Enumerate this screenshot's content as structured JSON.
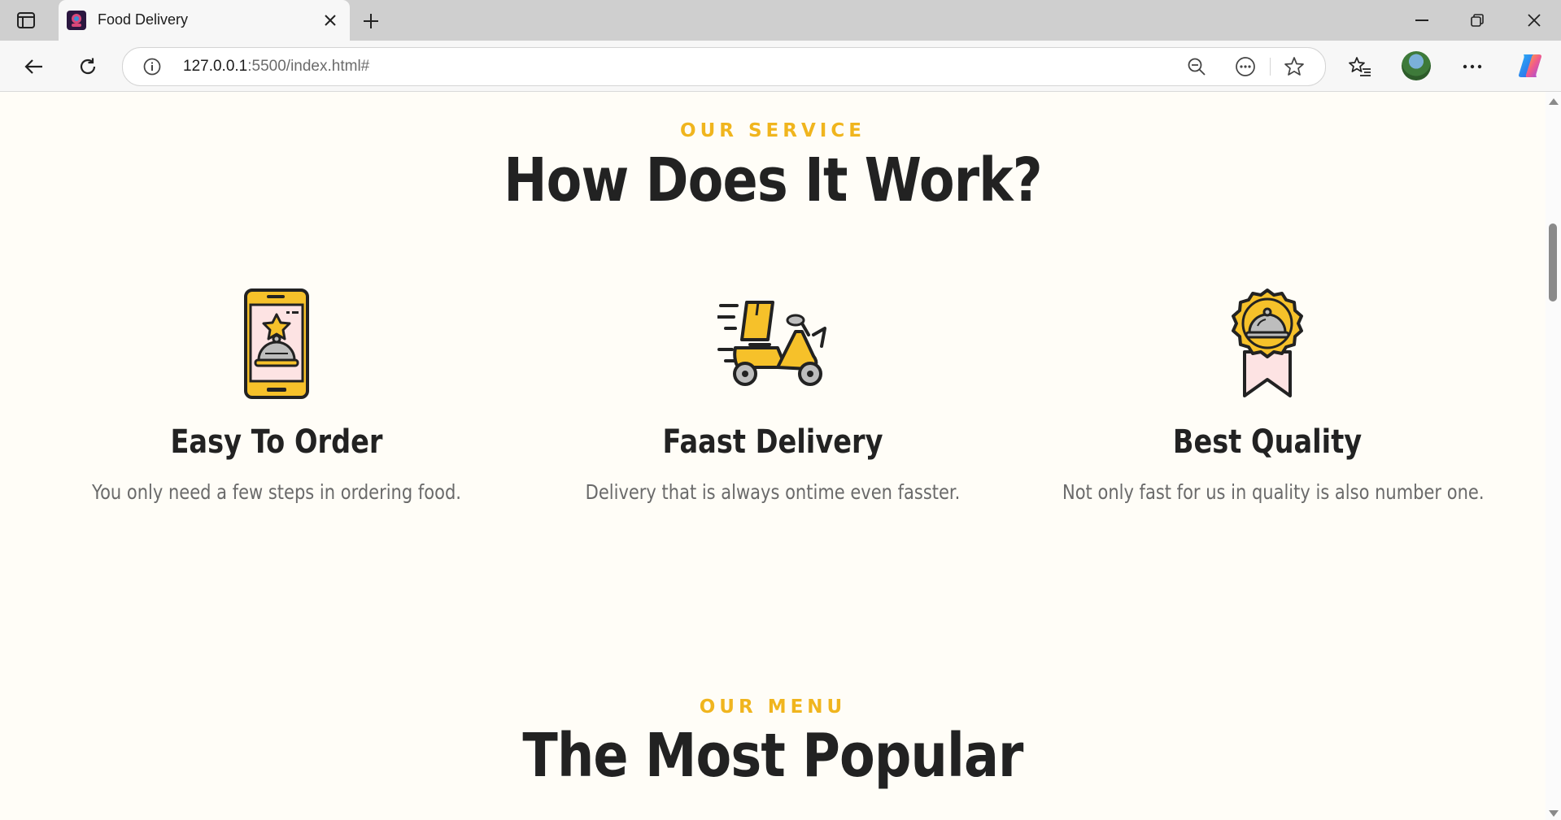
{
  "browser": {
    "tab_title": "Food Delivery",
    "url_host": "127.0.0.1",
    "url_rest": ":5500/index.html#"
  },
  "service": {
    "eyebrow": "OUR SERVICE",
    "heading": "How Does It Work?",
    "steps": [
      {
        "icon": "phone-order-icon",
        "title": "Easy To Order",
        "desc": "You only need a few steps in ordering food."
      },
      {
        "icon": "scooter-delivery-icon",
        "title": "Faast Delivery",
        "desc": "Delivery that is always ontime even fasster."
      },
      {
        "icon": "quality-badge-icon",
        "title": "Best Quality",
        "desc": "Not only fast for us in quality is also number one."
      }
    ]
  },
  "menu": {
    "eyebrow": "OUR MENU",
    "heading": "The Most Popular"
  },
  "colors": {
    "accent": "#f0b51e",
    "heading": "#222222",
    "text": "#6a6a6a",
    "page_bg": "#fffdf7",
    "pink": "#fde3e3"
  }
}
